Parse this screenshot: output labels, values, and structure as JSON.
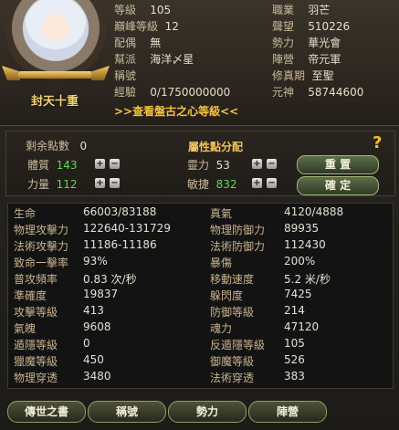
{
  "character": {
    "title": "封天十重",
    "info_left": [
      {
        "label": "等級",
        "value": "105"
      },
      {
        "label": "巔峰等級",
        "value": "12"
      },
      {
        "label": "配偶",
        "value": "無"
      },
      {
        "label": "幫派",
        "value": "海洋〆星"
      },
      {
        "label": "稱號",
        "value": ""
      },
      {
        "label": "經驗",
        "value": "0/1750000000"
      }
    ],
    "info_right": [
      {
        "label": "職業",
        "value": "羽芒"
      },
      {
        "label": "聲望",
        "value": "510226"
      },
      {
        "label": "勢力",
        "value": "華光會"
      },
      {
        "label": "陣營",
        "value": "帝元軍"
      },
      {
        "label": "修真期",
        "value": "至聖"
      },
      {
        "label": "元神",
        "value": "58744600"
      }
    ],
    "link": ">>查看盤古之心等級<<"
  },
  "attributes": {
    "title": "屬性點分配",
    "remaining_label": "剩余點數",
    "remaining_value": "0",
    "stats": [
      {
        "label": "體質",
        "value": "143"
      },
      {
        "label": "靈力",
        "value": "53"
      },
      {
        "label": "力量",
        "value": "112"
      },
      {
        "label": "敏捷",
        "value": "832"
      }
    ],
    "reset_label": "重 置",
    "confirm_label": "確 定",
    "plus": "+",
    "minus": "−",
    "help": "?"
  },
  "stats_table": [
    {
      "l1": "生命",
      "v1": "66003/83188",
      "l2": "真氣",
      "v2": "4120/4888"
    },
    {
      "l1": "物理攻擊力",
      "v1": "122640-131729",
      "l2": "物理防御力",
      "v2": "89935"
    },
    {
      "l1": "法術攻擊力",
      "v1": "11186-11186",
      "l2": "法術防御力",
      "v2": "112430"
    },
    {
      "l1": "致命一擊率",
      "v1": "93%",
      "l2": "暴傷",
      "v2": "200%"
    },
    {
      "l1": "普攻頻率",
      "v1": "0.83 次/秒",
      "l2": "移動速度",
      "v2": "5.2 米/秒"
    },
    {
      "l1": "準確度",
      "v1": "19837",
      "l2": "躲閃度",
      "v2": "7425"
    },
    {
      "l1": "攻擊等級",
      "v1": "413",
      "l2": "防御等級",
      "v2": "214"
    },
    {
      "l1": "氣魄",
      "v1": "9608",
      "l2": "魂力",
      "v2": "47120"
    },
    {
      "l1": "遁隱等級",
      "v1": "0",
      "l2": "反遁隱等級",
      "v2": "105"
    },
    {
      "l1": "獵魔等級",
      "v1": "450",
      "l2": "御魔等級",
      "v2": "526"
    },
    {
      "l1": "物理穿透",
      "v1": "3480",
      "l2": "法術穿透",
      "v2": "383"
    }
  ],
  "tabs": [
    {
      "label": "傳世之書"
    },
    {
      "label": "稱號"
    },
    {
      "label": "勢力"
    },
    {
      "label": "陣營"
    }
  ],
  "colors": {
    "accent": "#f6c33d",
    "stat_green": "#5cdc4a"
  }
}
